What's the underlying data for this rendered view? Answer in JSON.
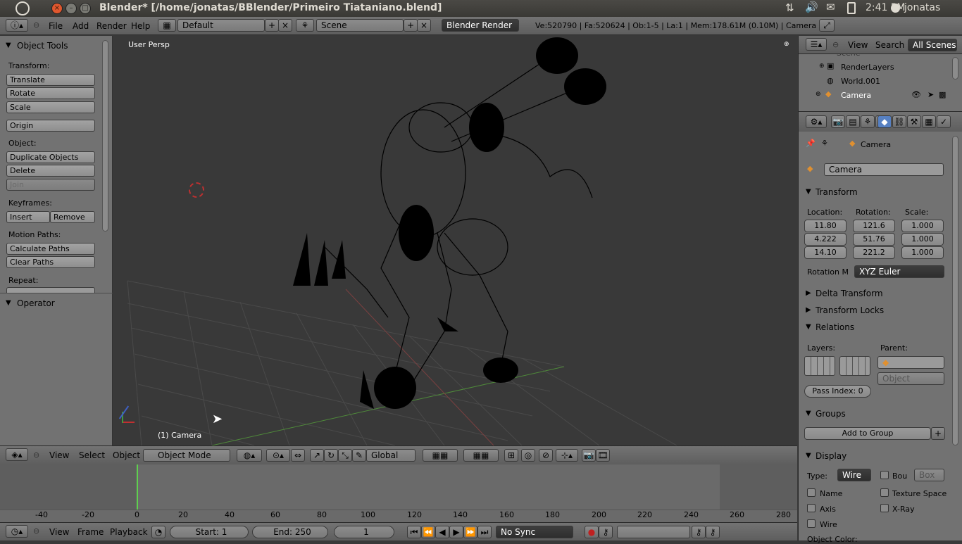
{
  "os": {
    "window_title": "Blender* [/home/jonatas/BBlender/Primeiro Tiataniano.blend]",
    "clock": "2:41 PM",
    "user": "jonatas"
  },
  "header": {
    "menus": [
      "File",
      "Add",
      "Render",
      "Help"
    ],
    "screen_layout": "Default",
    "scene": "Scene",
    "render_engine": "Blender Render",
    "stats": "Ve:520790 | Fa:520624 | Ob:1-5 | La:1 | Mem:178.61M (0.10M) | Camera"
  },
  "tools": {
    "title": "Object Tools",
    "transform_label": "Transform:",
    "translate": "Translate",
    "rotate": "Rotate",
    "scale": "Scale",
    "origin": "Origin",
    "object_label": "Object:",
    "duplicate": "Duplicate Objects",
    "delete": "Delete",
    "join": "Join",
    "keyframes_label": "Keyframes:",
    "insert": "Insert",
    "remove": "Remove",
    "motion_label": "Motion Paths:",
    "calc_paths": "Calculate Paths",
    "clear_paths": "Clear Paths",
    "repeat_label": "Repeat:",
    "operator": "Operator"
  },
  "viewport": {
    "view_name": "User Persp",
    "object_label": "(1) Camera"
  },
  "view3d_header": {
    "menus": [
      "View",
      "Select",
      "Object"
    ],
    "mode": "Object Mode",
    "orientation": "Global"
  },
  "timeline": {
    "ticks": [
      "-40",
      "-20",
      "0",
      "20",
      "40",
      "60",
      "80",
      "100",
      "120",
      "140",
      "160",
      "180",
      "200",
      "220",
      "240",
      "260",
      "280"
    ],
    "menus": [
      "View",
      "Frame",
      "Playback"
    ],
    "start": "Start: 1",
    "end": "End: 250",
    "current": "1",
    "sync": "No Sync"
  },
  "outliner": {
    "menus": [
      "View",
      "Search"
    ],
    "filter": "All Scenes",
    "items": [
      "Scene",
      "RenderLayers",
      "World.001",
      "Camera"
    ]
  },
  "properties": {
    "breadcrumb": "Camera",
    "object_name": "Camera",
    "transform": {
      "title": "Transform",
      "location_label": "Location:",
      "rotation_label": "Rotation:",
      "scale_label": "Scale:",
      "location": [
        "11.80",
        "4.222",
        "14.10"
      ],
      "rotation": [
        "121.6",
        "51.76",
        "221.2"
      ],
      "scale": [
        "1.000",
        "1.000",
        "1.000"
      ],
      "rotation_mode_label": "Rotation M",
      "rotation_mode": "XYZ Euler"
    },
    "delta_transform": "Delta Transform",
    "transform_locks": "Transform Locks",
    "relations": {
      "title": "Relations",
      "layers_label": "Layers:",
      "parent_label": "Parent:",
      "parent_type": "Object",
      "pass_index": "Pass Index: 0"
    },
    "groups": {
      "title": "Groups",
      "add": "Add to Group"
    },
    "display": {
      "title": "Display",
      "type_label": "Type:",
      "type": "Wire",
      "bounds": "Bou",
      "bounds_type": "Box",
      "name": "Name",
      "texture_space": "Texture Space",
      "axis": "Axis",
      "xray": "X-Ray",
      "wire": "Wire",
      "object_color": "Object Color:"
    }
  }
}
